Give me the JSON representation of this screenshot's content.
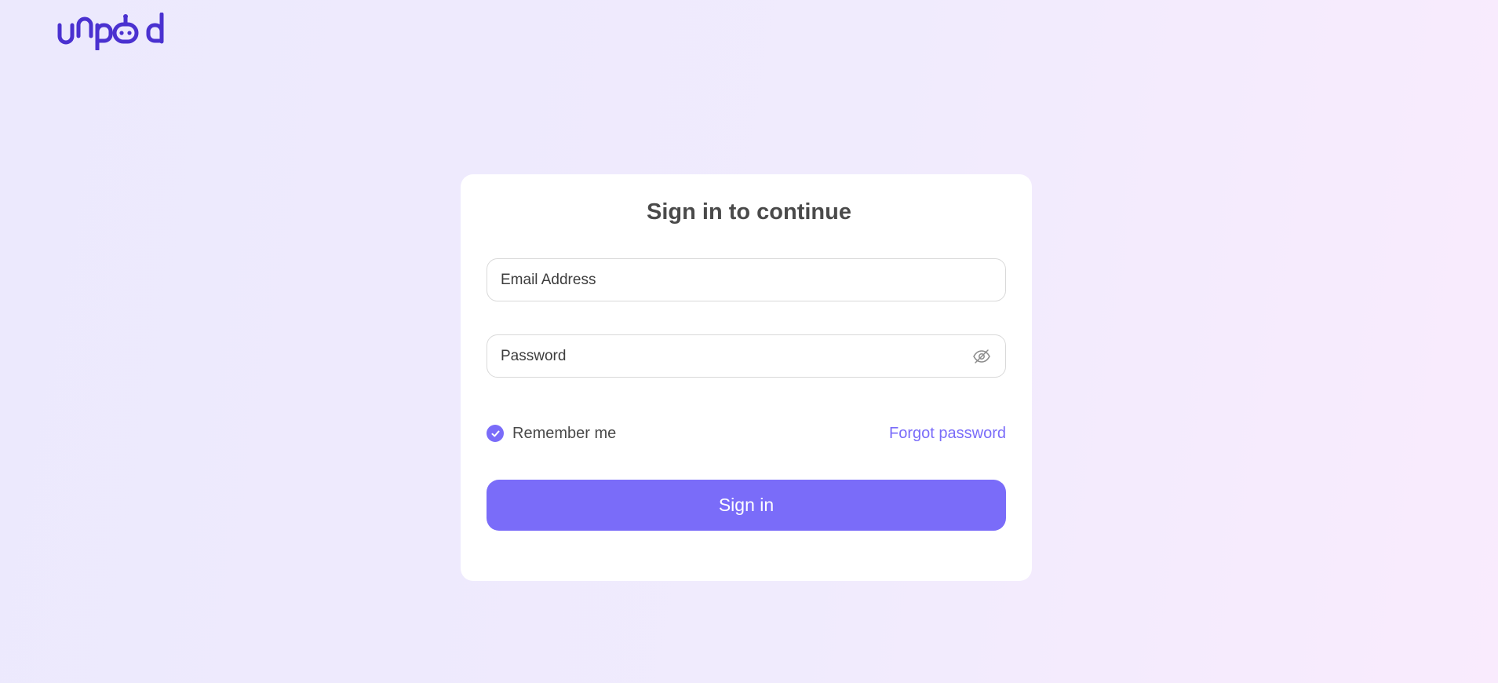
{
  "brand": {
    "name": "unpod",
    "color": "#4a31d0"
  },
  "form": {
    "title": "Sign in to continue",
    "email": {
      "value": "",
      "placeholder": "Email Address"
    },
    "password": {
      "value": "",
      "placeholder": "Password",
      "visibility_icon": "eye-off-icon"
    },
    "remember": {
      "label": "Remember me",
      "checked": true,
      "icon": "check-icon"
    },
    "forgot_label": "Forgot password",
    "submit_label": "Sign in"
  },
  "colors": {
    "accent": "#7a6cf9",
    "card": "#ffffff",
    "text": "#4a4a4a"
  }
}
